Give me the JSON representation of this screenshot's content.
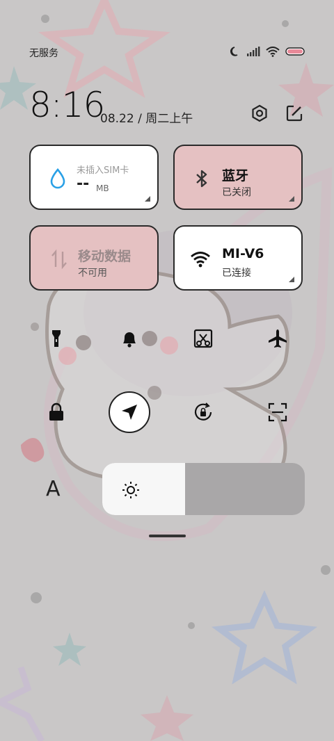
{
  "status_bar": {
    "carrier": "无服务"
  },
  "clock": {
    "time": "8:16",
    "date": "08.22 / 周二上午"
  },
  "tiles": [
    {
      "title": "",
      "sub": "未插入SIM卡",
      "value": "--",
      "unit": "MB",
      "icon": "water-drop-icon",
      "state": "off"
    },
    {
      "title": "蓝牙",
      "sub": "已关闭",
      "icon": "bluetooth-icon",
      "state": "pink"
    },
    {
      "title": "移动数据",
      "sub": "不可用",
      "icon": "mobile-data-icon",
      "state": "pink"
    },
    {
      "title": "MI-V6",
      "sub": "已连接",
      "icon": "wifi-icon",
      "state": "on"
    }
  ],
  "controls": {
    "row1": [
      "flashlight-icon",
      "bell-icon",
      "screenshot-icon",
      "airplane-icon"
    ],
    "row2": [
      "lock-icon",
      "location-icon",
      "rotation-lock-icon",
      "scan-icon"
    ]
  },
  "font_button": "A",
  "brightness": {
    "level": 0.41
  },
  "colors": {
    "pink_tile": "#e5c1c2",
    "accent_blue": "#29a0e6",
    "battery": "#e88a99"
  }
}
